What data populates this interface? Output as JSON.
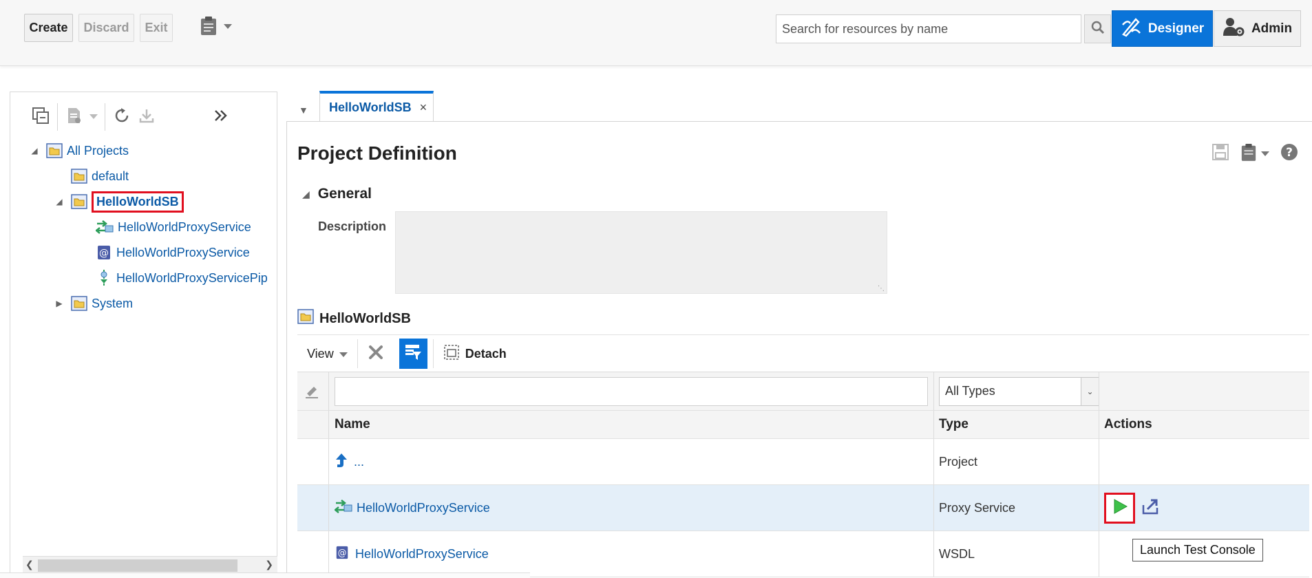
{
  "topbar": {
    "create_label": "Create",
    "discard_label": "Discard",
    "exit_label": "Exit",
    "search_placeholder": "Search for resources by name",
    "designer_label": "Designer",
    "admin_label": "Admin"
  },
  "navigator": {
    "tree": {
      "all_projects": "All Projects",
      "default": "default",
      "helloworldsb": "HelloWorldSB",
      "children": [
        {
          "label": "HelloWorldProxyService",
          "icon": "proxy-service-icon"
        },
        {
          "label": "HelloWorldProxyService",
          "icon": "wsdl-icon"
        },
        {
          "label": "HelloWorldProxyServicePip",
          "icon": "pipeline-icon"
        }
      ],
      "system": "System"
    }
  },
  "tabs": [
    {
      "label": "HelloWorldSB",
      "close": "×"
    }
  ],
  "main": {
    "page_title": "Project Definition",
    "general_label": "General",
    "description_label": "Description",
    "description_value": "",
    "project_label": "HelloWorldSB",
    "toolbar": {
      "view_label": "View",
      "detach_label": "Detach"
    },
    "table": {
      "filter_value": "",
      "type_filter": "All Types",
      "columns": [
        "Name",
        "Type",
        "Actions"
      ],
      "rows": [
        {
          "name": "...",
          "type": "Project",
          "icon": "up-arrow-icon"
        },
        {
          "name": "HelloWorldProxyService",
          "type": "Proxy Service",
          "icon": "proxy-service-icon"
        },
        {
          "name": "HelloWorldProxyService",
          "type": "WSDL",
          "icon": "wsdl-icon"
        }
      ]
    },
    "tooltip": "Launch Test Console"
  },
  "colors": {
    "accent": "#0a74d9",
    "link": "#0b5aa6",
    "highlight": "#e10f1f",
    "selected_row": "#e4eff9"
  }
}
